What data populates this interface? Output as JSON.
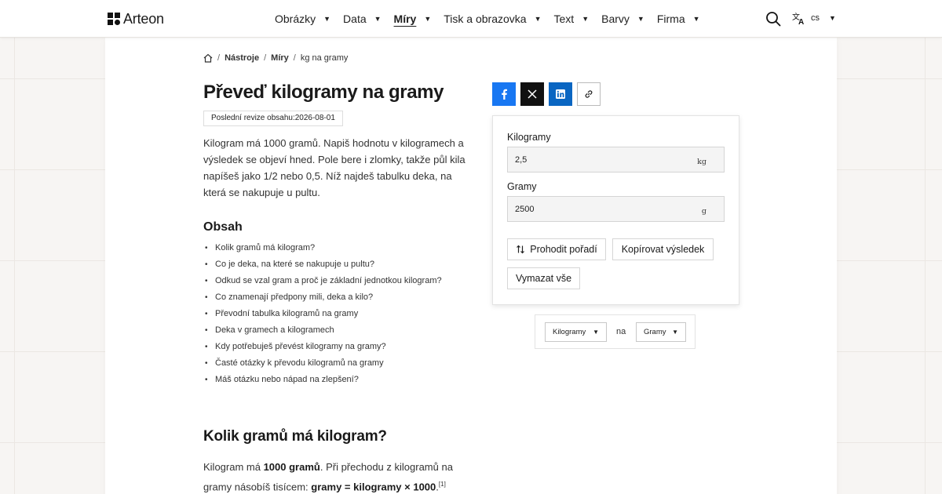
{
  "header": {
    "brand": "Arteon",
    "nav": [
      {
        "label": "Obrázky",
        "active": false
      },
      {
        "label": "Data",
        "active": false
      },
      {
        "label": "Míry",
        "active": true
      },
      {
        "label": "Tisk a obrazovka",
        "active": false
      },
      {
        "label": "Text",
        "active": false
      },
      {
        "label": "Barvy",
        "active": false
      },
      {
        "label": "Firma",
        "active": false
      }
    ],
    "search_icon": "search-icon",
    "language": "cs",
    "language_icon": "translate-icon"
  },
  "breadcrumb": {
    "home_icon": "home-icon",
    "items": [
      "Nástroje",
      "Míry"
    ],
    "current": "kg na gramy"
  },
  "article": {
    "title": "Převeď kilogramy na gramy",
    "revision": "Poslední revize obsahu:2026-08-01",
    "intro": "Kilogram má 1000 gramů. Napiš hodnotu v kilogramech a výsledek se objeví hned. Pole bere i zlomky, takže půl kila napíšeš jako 1/2 nebo 0,5. Níž najdeš tabulku deka, na která se nakupuje u pultu.",
    "toc_title": "Obsah",
    "toc": [
      "Kolik gramů má kilogram?",
      "Co je deka, na které se nakupuje u pultu?",
      "Odkud se vzal gram a proč je základní jednotkou kilogram?",
      "Co znamenají předpony mili, deka a kilo?",
      "Převodní tabulka kilogramů na gramy",
      "Deka v gramech a kilogramech",
      "Kdy potřebuješ převést kilogramy na gramy?",
      "Časté otázky k převodu kilogramů na gramy",
      "Máš otázku nebo nápad na zlepšení?"
    ],
    "section_title": "Kolik gramů má kilogram?",
    "section_text": {
      "p1": "Kilogram má ",
      "b1": "1000 gramů",
      "p2": ". Při přechodu z kilogramů na gramy násobíš tisícem: ",
      "b2": "gramy = kilogramy × 1000",
      "p3": ".",
      "ref": "[1]"
    }
  },
  "share": {
    "icons": [
      "facebook-icon",
      "x-icon",
      "linkedin-icon",
      "link-icon"
    ],
    "colors": {
      "facebook": "#1877f2",
      "x": "#111111",
      "linkedin": "#0a66c2"
    }
  },
  "converter": {
    "from_label": "Kilogramy",
    "from_value": "2,5",
    "from_unit": "kg",
    "to_label": "Gramy",
    "to_value": "2500",
    "to_unit": "g",
    "swap_label": "Prohodit pořadí",
    "swap_icon": "swap-vertical-icon",
    "copy_label": "Kopírovat výsledek",
    "clear_label": "Vymazat vše"
  },
  "unit_selector": {
    "from": "Kilogramy",
    "connector": "na",
    "to": "Gramy"
  }
}
